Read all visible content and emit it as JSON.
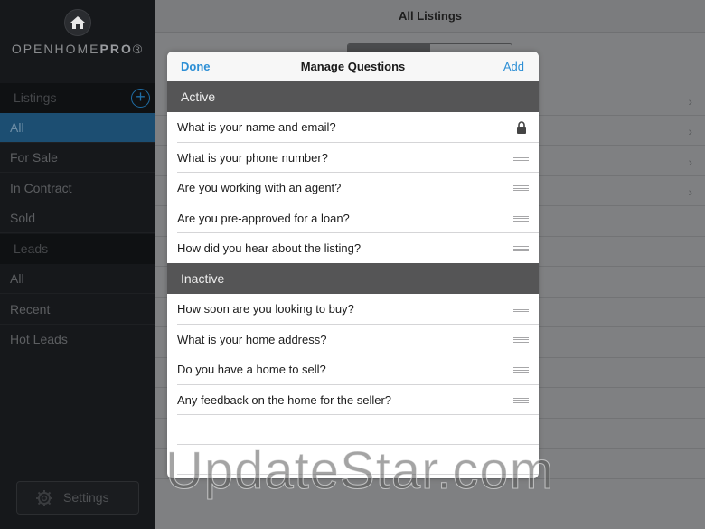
{
  "sidebar": {
    "brand_light": "OPENHOME",
    "brand_bold": "PRO",
    "brand_mark": "®",
    "sections": [
      {
        "label": "Listings",
        "items": [
          "All",
          "For Sale",
          "In Contract",
          "Sold"
        ]
      },
      {
        "label": "Leads",
        "items": [
          "All",
          "Recent",
          "Hot Leads"
        ]
      }
    ],
    "active_item": "All",
    "settings_label": "Settings"
  },
  "main": {
    "title": "All Listings"
  },
  "modal": {
    "title": "Manage Questions",
    "done_label": "Done",
    "add_label": "Add",
    "groups": [
      {
        "label": "Active",
        "questions": [
          {
            "text": "What is your name and email?",
            "icon": "lock-icon"
          },
          {
            "text": "What is your phone number?",
            "icon": "drag-handle-icon"
          },
          {
            "text": "Are you working with an agent?",
            "icon": "drag-handle-icon"
          },
          {
            "text": "Are you pre-approved for a loan?",
            "icon": "drag-handle-icon"
          },
          {
            "text": "How did you hear about the listing?",
            "icon": "drag-handle-icon"
          }
        ]
      },
      {
        "label": "Inactive",
        "questions": [
          {
            "text": "How soon are you looking to buy?",
            "icon": "drag-handle-icon"
          },
          {
            "text": "What is your home address?",
            "icon": "drag-handle-icon"
          },
          {
            "text": "Do you have a home to sell?",
            "icon": "drag-handle-icon"
          },
          {
            "text": "Any feedback on the home for the seller?",
            "icon": "drag-handle-icon"
          }
        ]
      }
    ]
  },
  "watermark": "UpdateStar.com",
  "colors": {
    "accent": "#2d8fd5",
    "sidebar_bg": "#16181b",
    "group_header_bg": "#555556"
  }
}
